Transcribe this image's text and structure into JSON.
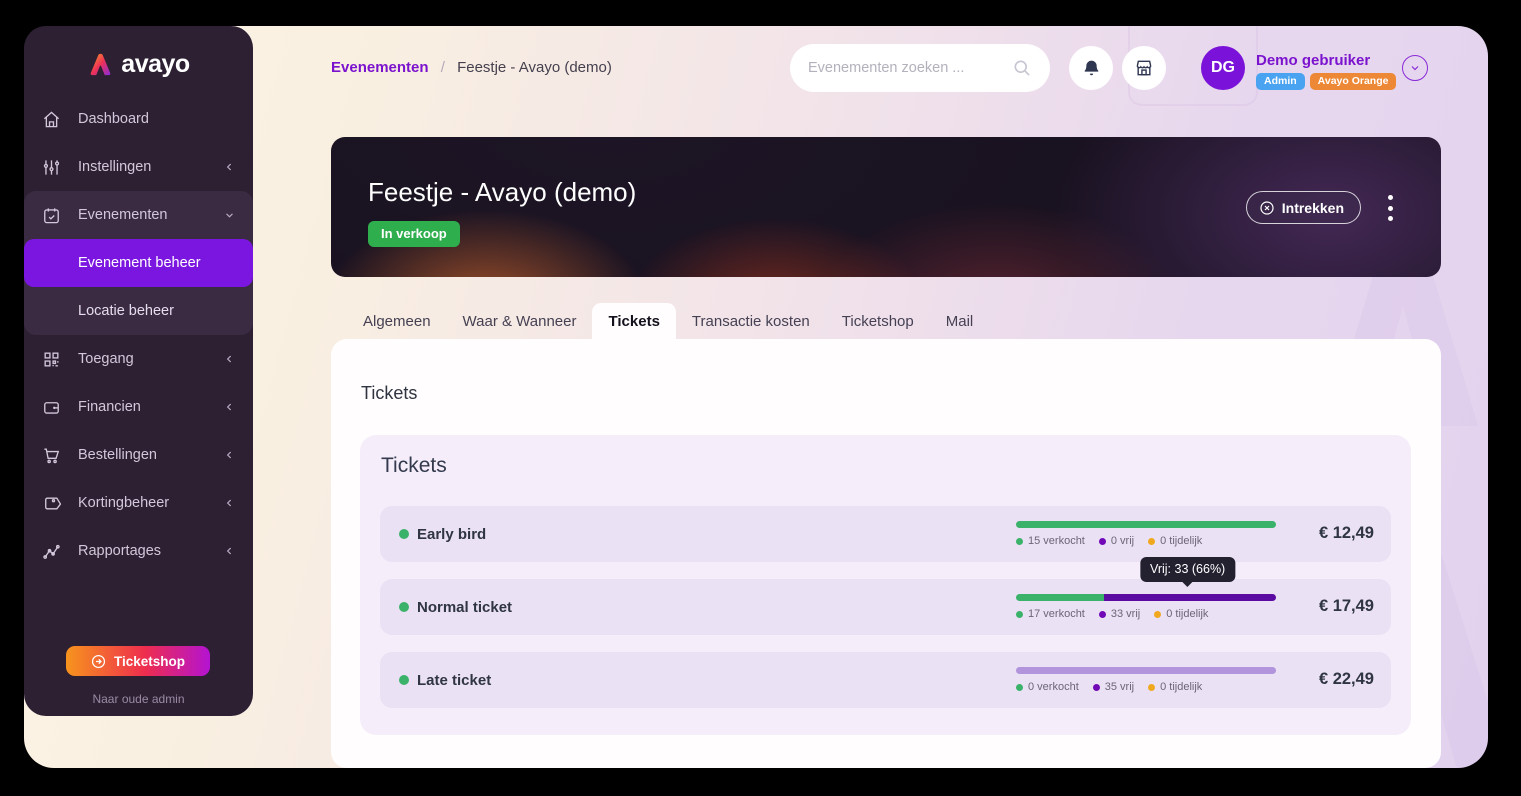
{
  "brand": {
    "name": "avayo"
  },
  "colors": {
    "accent": "#7b16e0",
    "sold_green": "#3bb26a",
    "free_purple": "#7209b7",
    "free_purple_bar_dark": "#5b0ba1",
    "free_purple_bar_light": "#b294dc",
    "temp_amber": "#f0a91f",
    "badge_admin": "#4aa3f0",
    "badge_org": "#ed8936",
    "status_green": "#2fae4e"
  },
  "sidebar": {
    "nav": [
      {
        "label": "Dashboard",
        "icon": "home-icon"
      },
      {
        "label": "Instellingen",
        "icon": "sliders-icon",
        "chevron": "left"
      },
      {
        "label": "Evenementen",
        "icon": "calendar-icon",
        "chevron": "down",
        "expanded": true,
        "children": [
          {
            "label": "Evenement beheer",
            "active": true
          },
          {
            "label": "Locatie beheer",
            "active": false
          }
        ]
      },
      {
        "label": "Toegang",
        "icon": "qr-icon",
        "chevron": "left"
      },
      {
        "label": "Financien",
        "icon": "wallet-icon",
        "chevron": "left"
      },
      {
        "label": "Bestellingen",
        "icon": "cart-icon",
        "chevron": "left"
      },
      {
        "label": "Kortingbeheer",
        "icon": "tag-icon",
        "chevron": "left"
      },
      {
        "label": "Rapportages",
        "icon": "chart-icon",
        "chevron": "left"
      }
    ],
    "ticketshop_button": "Ticketshop",
    "old_admin_link": "Naar oude admin"
  },
  "topbar": {
    "breadcrumb": {
      "parent": "Evenementen",
      "separator": "/",
      "current": "Feestje - Avayo (demo)"
    },
    "search_placeholder": "Evenementen zoeken ...",
    "user": {
      "initials": "DG",
      "name": "Demo gebruiker",
      "badges": [
        {
          "label": "Admin",
          "color_key": "badge_admin"
        },
        {
          "label": "Avayo Orange",
          "color_key": "badge_org"
        }
      ]
    }
  },
  "hero": {
    "title": "Feestje - Avayo (demo)",
    "status_badge": "In verkoop",
    "withdraw_button": "Intrekken"
  },
  "tabs": [
    {
      "label": "Algemeen",
      "active": false
    },
    {
      "label": "Waar & Wanneer",
      "active": false
    },
    {
      "label": "Tickets",
      "active": true
    },
    {
      "label": "Transactie kosten",
      "active": false
    },
    {
      "label": "Ticketshop",
      "active": false
    },
    {
      "label": "Mail",
      "active": false
    }
  ],
  "content": {
    "section_title": "Tickets",
    "card_title": "Tickets",
    "tooltip": {
      "text": "Vrij: 33 (66%)",
      "row_index": 1
    },
    "tickets": [
      {
        "name": "Early bird",
        "price": "€ 12,49",
        "bar": [
          {
            "color_key": "sold_green",
            "pct": 100
          }
        ],
        "legend": [
          {
            "color_key": "sold_green",
            "label": "15 verkocht"
          },
          {
            "color_key": "free_purple",
            "label": "0 vrij"
          },
          {
            "color_key": "temp_amber",
            "label": "0 tijdelijk"
          }
        ]
      },
      {
        "name": "Normal ticket",
        "price": "€ 17,49",
        "bar": [
          {
            "color_key": "sold_green",
            "pct": 34
          },
          {
            "color_key": "free_purple_bar_dark",
            "pct": 66
          }
        ],
        "legend": [
          {
            "color_key": "sold_green",
            "label": "17 verkocht"
          },
          {
            "color_key": "free_purple",
            "label": "33 vrij"
          },
          {
            "color_key": "temp_amber",
            "label": "0 tijdelijk"
          }
        ]
      },
      {
        "name": "Late ticket",
        "price": "€ 22,49",
        "bar": [
          {
            "color_key": "free_purple_bar_light",
            "pct": 100
          }
        ],
        "legend": [
          {
            "color_key": "sold_green",
            "label": "0 verkocht"
          },
          {
            "color_key": "free_purple",
            "label": "35 vrij"
          },
          {
            "color_key": "temp_amber",
            "label": "0 tijdelijk"
          }
        ]
      }
    ]
  }
}
